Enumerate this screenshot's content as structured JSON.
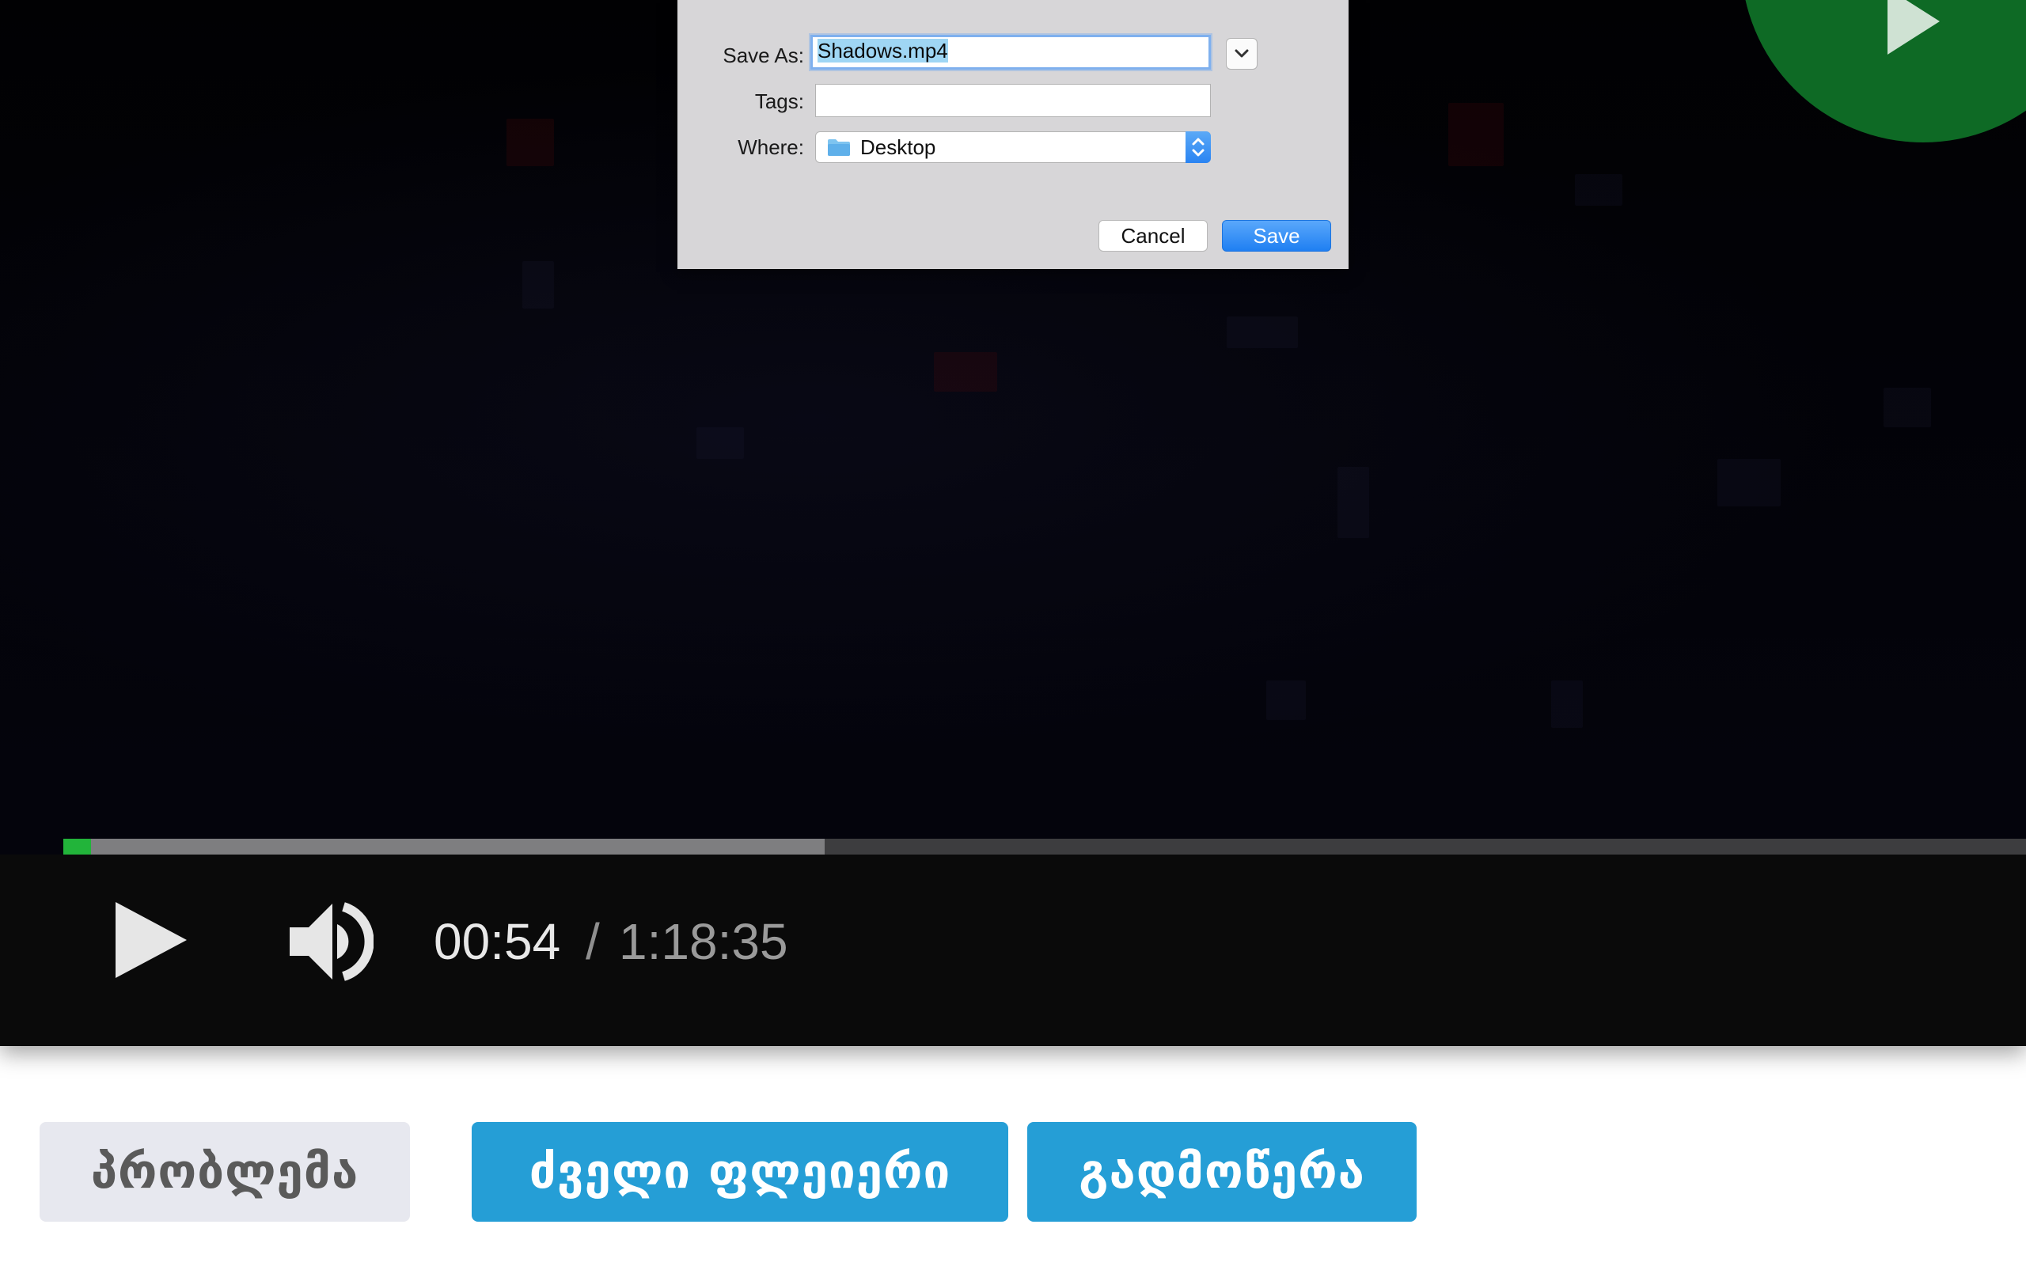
{
  "dialog": {
    "save_as_label": "Save As:",
    "save_as_value": "Shadows.mp4",
    "tags_label": "Tags:",
    "tags_value": "",
    "where_label": "Where:",
    "where_value": "Desktop",
    "expand_icon": "chevron-down-icon",
    "folder_icon": "folder-icon",
    "stepper_icon": "up-down-arrows-icon",
    "cancel_label": "Cancel",
    "save_label": "Save"
  },
  "player": {
    "current_time": "00:54",
    "separator": "/",
    "total_time": "1:18:35",
    "played_fraction": 0.014,
    "buffered_fraction": 0.388,
    "colors": {
      "progress_played": "#22b43a",
      "progress_buffer": "#7e7e80",
      "big_play": "#0e6a25"
    },
    "icons": [
      "play-icon",
      "volume-icon",
      "big-play-icon"
    ]
  },
  "bottom_buttons": {
    "problem": "პრობლემა",
    "old_player": "ძველი ფლეიერი",
    "download": "გადმოწერა",
    "colors": {
      "primary": "#259ed6",
      "secondary": "#e7e8ef"
    }
  }
}
